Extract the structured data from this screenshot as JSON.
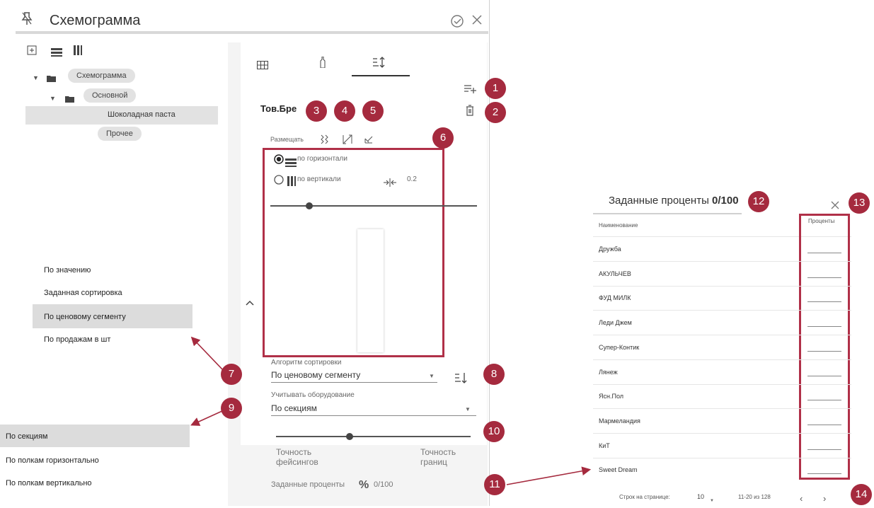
{
  "header": {
    "title": "Схемограмма",
    "pin_icon": "pin-icon",
    "check_icon": "check-circle-icon",
    "close_icon": "close-icon"
  },
  "tree": {
    "nodes": [
      {
        "label": "Схемограмма"
      },
      {
        "label": "Основной"
      },
      {
        "label": "Шоколадная паста"
      },
      {
        "label": "Прочее"
      }
    ]
  },
  "tabs": [
    "grid-icon",
    "bottle-icon",
    "sort-icon"
  ],
  "editor": {
    "product_label": "Тов.Бре",
    "place_label": "Размещать",
    "radio_horizontal": "по горизонтали",
    "radio_vertical": "по вертикали",
    "gap_value": "0.2",
    "sort_algo_label": "Алгоритм сортировки",
    "sort_algo_value": "По ценовому сегменту",
    "equip_label": "Учитывать оборудование",
    "equip_value": "По секциям",
    "accuracy_facings": "Точность\nфейсингов",
    "accuracy_bounds": "Точность\nграниц",
    "pct_label": "Заданные проценты",
    "pct_value": "0/100"
  },
  "sort_menu": [
    "По значению",
    "Заданная сортировка",
    "По ценовому сегменту",
    "По продажам в шт"
  ],
  "equip_menu": [
    "По секциям",
    "По полкам горизонтально",
    "По полкам вертикально"
  ],
  "badges": [
    "1",
    "2",
    "3",
    "4",
    "5",
    "6",
    "7",
    "8",
    "9",
    "10",
    "11",
    "12",
    "13",
    "14"
  ],
  "dialog": {
    "title": "Заданные проценты",
    "count": "0/100",
    "col_name": "Наименование",
    "col_pct": "Проценты",
    "rows": [
      "Дружба",
      "АКУЛЬЧЕВ",
      "ФУД МИЛК",
      "Леди Джем",
      "Супер-Контик",
      "Лянеж",
      "Ясн.Пол",
      "Мармеландия",
      "КиТ",
      "Sweet Dream"
    ],
    "footer": {
      "rows_per_page_label": "Строк на странице:",
      "rows_per_page": "10",
      "range": "11-20 из 128"
    }
  },
  "colors": {
    "accent": "#a52a3e"
  }
}
